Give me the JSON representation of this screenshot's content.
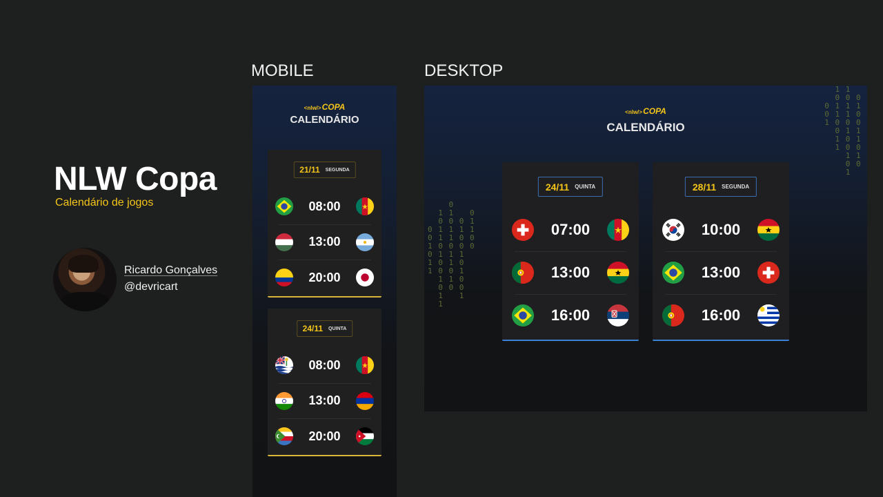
{
  "intro": {
    "title": "NLW Copa",
    "subtitle": "Calendário de jogos",
    "author_name": "Ricardo Gonçalves",
    "author_handle": "@devricart"
  },
  "labels": {
    "mobile": "MOBILE",
    "desktop": "DESKTOP"
  },
  "brand": {
    "tag": "<nlw/>",
    "name": "COPA"
  },
  "calendar_title": "CALENDÁRIO",
  "mobile": {
    "cards": [
      {
        "date": "21/11",
        "weekday": "SEGUNDA",
        "matches": [
          {
            "home": "brazil",
            "time": "08:00",
            "away": "cameroon"
          },
          {
            "home": "hungary",
            "time": "13:00",
            "away": "argentina"
          },
          {
            "home": "colombia",
            "time": "20:00",
            "away": "japan"
          }
        ]
      },
      {
        "date": "24/11",
        "weekday": "QUINTA",
        "matches": [
          {
            "home": "british-indian-ocean-territory",
            "time": "08:00",
            "away": "cameroon"
          },
          {
            "home": "india",
            "time": "13:00",
            "away": "armenia"
          },
          {
            "home": "comoros",
            "time": "20:00",
            "away": "jordan"
          }
        ]
      }
    ]
  },
  "desktop": {
    "cards": [
      {
        "date": "24/11",
        "weekday": "QUINTA",
        "matches": [
          {
            "home": "switzerland",
            "time": "07:00",
            "away": "cameroon"
          },
          {
            "home": "portugal",
            "time": "13:00",
            "away": "ghana"
          },
          {
            "home": "brazil",
            "time": "16:00",
            "away": "serbia"
          }
        ]
      },
      {
        "date": "28/11",
        "weekday": "SEGUNDA",
        "matches": [
          {
            "home": "south-korea",
            "time": "10:00",
            "away": "ghana"
          },
          {
            "home": "brazil",
            "time": "13:00",
            "away": "switzerland"
          },
          {
            "home": "portugal",
            "time": "16:00",
            "away": "uruguay"
          }
        ]
      }
    ]
  },
  "colors": {
    "accent_yellow": "#f5c518",
    "accent_blue": "#3b82d6",
    "background": "#1e1f1f",
    "card": "#202020"
  }
}
